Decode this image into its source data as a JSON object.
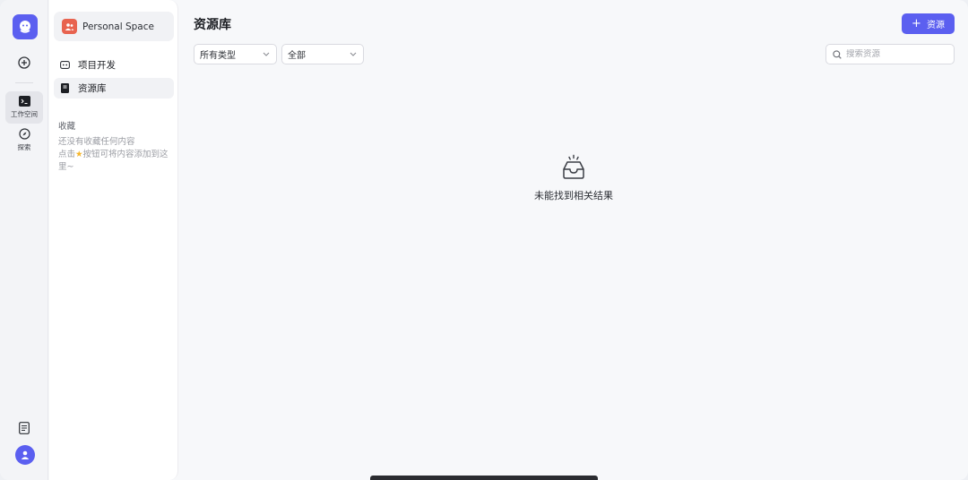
{
  "rail": {
    "workspace_label": "工作空间",
    "explore_label": "探索"
  },
  "panel": {
    "space_name": "Personal Space",
    "nav": [
      {
        "label": "项目开发"
      },
      {
        "label": "资源库"
      }
    ],
    "favorites_title": "收藏",
    "favorites_empty_line1": "还没有收藏任何内容",
    "favorites_empty_line2_pre": "点击",
    "favorites_empty_line2_post": "按钮可将内容添加到这里~"
  },
  "main": {
    "title": "资源库",
    "add_button_label": "资源",
    "type_filter": "所有类型",
    "scope_filter": "全部",
    "search_placeholder": "搜索资源",
    "empty_message": "未能找到相关结果"
  },
  "colors": {
    "accent": "#5b5ff0",
    "space_icon": "#e8634f"
  }
}
